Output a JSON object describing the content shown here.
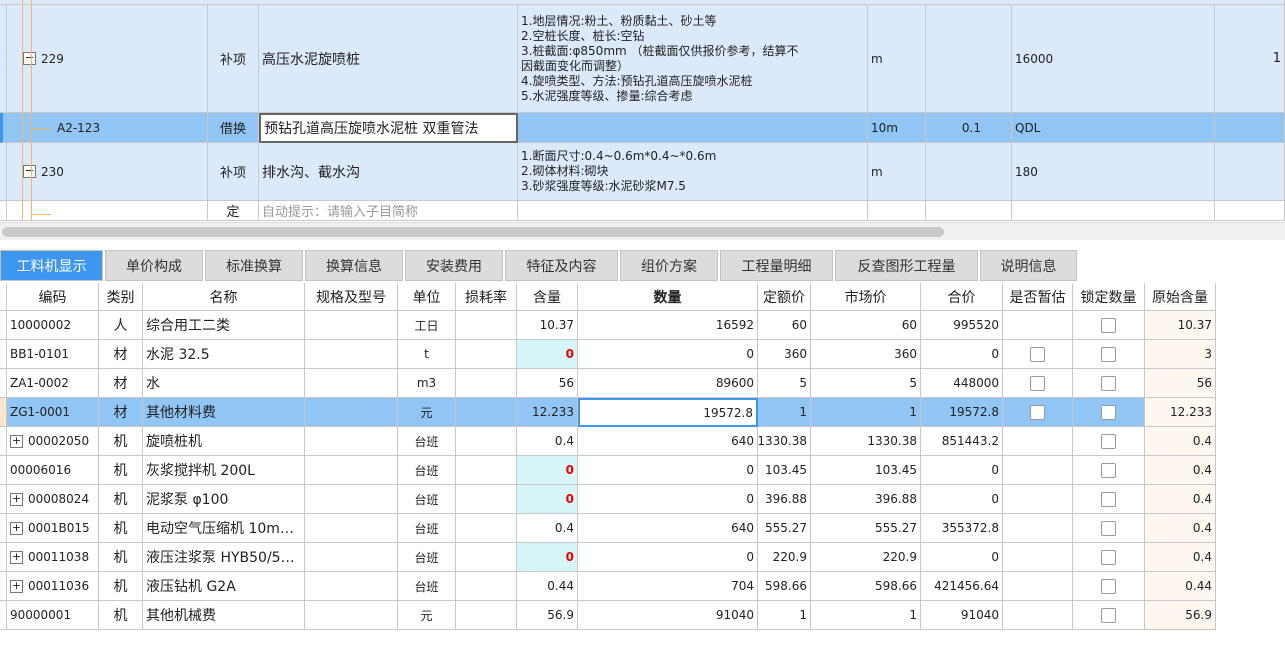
{
  "upper": {
    "rows": [
      {
        "code": "229",
        "type": "补项",
        "name": "高压水泥旋喷桩",
        "feature": "1.地层情况:粉土、粉质黏土、砂土等\n2.空桩长度、桩长:空钻\n3.桩截面:φ850mm （桩截面仅供报价参考，结算不\n因截面变化而调整）\n4.旋喷类型、方法:预钻孔道高压旋喷水泥桩\n5.水泥强度等级、掺量:综合考虑",
        "unit": "m",
        "qty": "",
        "expr": "16000",
        "extra": "1"
      },
      {
        "code": "A2-123",
        "type": "借换",
        "name": "预钻孔道高压旋喷水泥桩 双重管法",
        "feature": "",
        "unit": "10m",
        "qty": "0.1",
        "expr": "QDL",
        "extra": ""
      },
      {
        "code": "230",
        "type": "补项",
        "name": "排水沟、截水沟",
        "feature": "1.断面尺寸:0.4~0.6m*0.4~*0.6m\n2.砌体材料:砌块\n3.砂浆强度等级:水泥砂浆M7.5",
        "unit": "m",
        "qty": "",
        "expr": "180",
        "extra": ""
      },
      {
        "code": "",
        "type": "定",
        "name": "自动提示：请输入子目简称",
        "feature": "",
        "unit": "",
        "qty": "",
        "expr": "",
        "extra": ""
      }
    ]
  },
  "tabs": [
    "工料机显示",
    "单价构成",
    "标准换算",
    "换算信息",
    "安装费用",
    "特征及内容",
    "组价方案",
    "工程量明细",
    "反查图形工程量",
    "说明信息"
  ],
  "lower": {
    "headers": [
      "编码",
      "类别",
      "名称",
      "规格及型号",
      "单位",
      "损耗率",
      "含量",
      "数量",
      "定额价",
      "市场价",
      "合价",
      "是否暂估",
      "锁定数量",
      "原始含量"
    ],
    "rows": [
      {
        "code": "10000002",
        "type": "人",
        "name": "综合用工二类",
        "spec": "",
        "unit": "工日",
        "loss": "",
        "content": "10.37",
        "qty": "16592",
        "price": "60",
        "market": "60",
        "total": "995520",
        "est": false,
        "lock": true,
        "orig": "10.37"
      },
      {
        "code": "BB1-0101",
        "type": "材",
        "name": "水泥 32.5",
        "spec": "",
        "unit": "t",
        "loss": "",
        "content": "0",
        "qty": "0",
        "price": "360",
        "market": "360",
        "total": "0",
        "est": true,
        "lock": true,
        "orig": "3"
      },
      {
        "code": "ZA1-0002",
        "type": "材",
        "name": "水",
        "spec": "",
        "unit": "m3",
        "loss": "",
        "content": "56",
        "qty": "89600",
        "price": "5",
        "market": "5",
        "total": "448000",
        "est": true,
        "lock": true,
        "orig": "56"
      },
      {
        "code": "ZG1-0001",
        "type": "材",
        "name": "其他材料费",
        "spec": "",
        "unit": "元",
        "loss": "",
        "content": "12.233",
        "qty": "19572.8",
        "price": "1",
        "market": "1",
        "total": "19572.8",
        "est": true,
        "lock": true,
        "orig": "12.233"
      },
      {
        "code": "00002050",
        "type": "机",
        "name": "旋喷桩机",
        "spec": "",
        "unit": "台班",
        "loss": "",
        "content": "0.4",
        "qty": "640",
        "price": "1330.38",
        "market": "1330.38",
        "total": "851443.2",
        "est": false,
        "lock": true,
        "orig": "0.4",
        "expand": true
      },
      {
        "code": "00006016",
        "type": "机",
        "name": "灰浆搅拌机 200L",
        "spec": "",
        "unit": "台班",
        "loss": "",
        "content": "0",
        "qty": "0",
        "price": "103.45",
        "market": "103.45",
        "total": "0",
        "est": false,
        "lock": true,
        "orig": "0.4"
      },
      {
        "code": "00008024",
        "type": "机",
        "name": "泥浆泵 φ100",
        "spec": "",
        "unit": "台班",
        "loss": "",
        "content": "0",
        "qty": "0",
        "price": "396.88",
        "market": "396.88",
        "total": "0",
        "est": false,
        "lock": true,
        "orig": "0.4",
        "expand": true
      },
      {
        "code": "0001B015",
        "type": "机",
        "name": "电动空气压缩机 10m…",
        "spec": "",
        "unit": "台班",
        "loss": "",
        "content": "0.4",
        "qty": "640",
        "price": "555.27",
        "market": "555.27",
        "total": "355372.8",
        "est": false,
        "lock": true,
        "orig": "0.4",
        "expand": true
      },
      {
        "code": "00011038",
        "type": "机",
        "name": "液压注浆泵 HYB50/5…",
        "spec": "",
        "unit": "台班",
        "loss": "",
        "content": "0",
        "qty": "0",
        "price": "220.9",
        "market": "220.9",
        "total": "0",
        "est": false,
        "lock": true,
        "orig": "0.4",
        "expand": true
      },
      {
        "code": "00011036",
        "type": "机",
        "name": "液压钻机 G2A",
        "spec": "",
        "unit": "台班",
        "loss": "",
        "content": "0.44",
        "qty": "704",
        "price": "598.66",
        "market": "598.66",
        "total": "421456.64",
        "est": false,
        "lock": true,
        "orig": "0.44",
        "expand": true
      },
      {
        "code": "90000001",
        "type": "机",
        "name": "其他机械费",
        "spec": "",
        "unit": "元",
        "loss": "",
        "content": "56.9",
        "qty": "91040",
        "price": "1",
        "market": "1",
        "total": "91040",
        "est": false,
        "lock": true,
        "orig": "56.9"
      }
    ]
  }
}
